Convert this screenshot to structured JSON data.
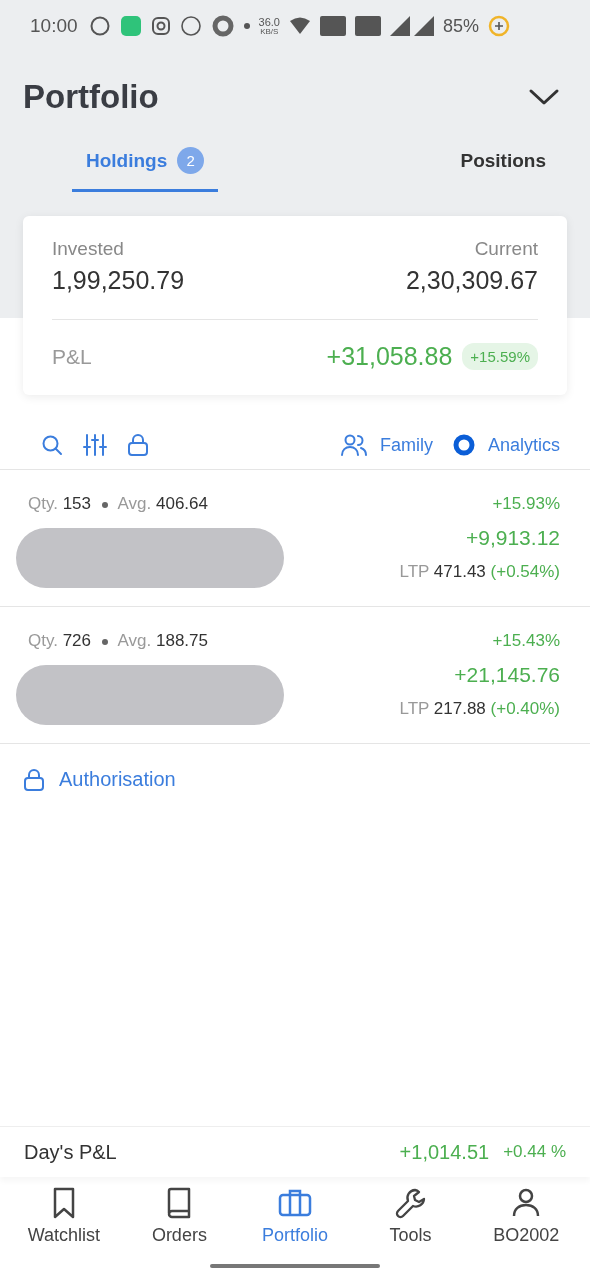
{
  "status_bar": {
    "time": "10:00",
    "speed": "36.0",
    "speed_unit": "KB/S",
    "battery": "85%"
  },
  "header": {
    "title": "Portfolio"
  },
  "tabs": [
    {
      "label": "Holdings",
      "badge": "2",
      "selected": true
    },
    {
      "label": "Positions",
      "selected": false
    }
  ],
  "summary": {
    "invested_label": "Invested",
    "invested": "1,99,250.79",
    "current_label": "Current",
    "current": "2,30,309.67",
    "pnl_label": "P&L",
    "pnl": "+31,058.88",
    "pnl_percent": "+15.59%"
  },
  "toolbar": {
    "family": "Family",
    "analytics": "Analytics"
  },
  "holdings": [
    {
      "qty_label": "Qty.",
      "qty": "153",
      "avg_label": "Avg.",
      "avg": "406.64",
      "change_percent": "+15.93%",
      "pnl": "+9,913.12",
      "ltp_label": "LTP",
      "ltp": "471.43",
      "ltp_change": "(+0.54%)"
    },
    {
      "qty_label": "Qty.",
      "qty": "726",
      "avg_label": "Avg.",
      "avg": "188.75",
      "change_percent": "+15.43%",
      "pnl": "+21,145.76",
      "ltp_label": "LTP",
      "ltp": "217.88",
      "ltp_change": "(+0.40%)"
    }
  ],
  "authorisation": "Authorisation",
  "day_pnl": {
    "label": "Day's P&L",
    "value": "+1,014.51",
    "percent": "+0.44 %"
  },
  "nav": [
    {
      "label": "Watchlist",
      "kind": "bookmark",
      "selected": false
    },
    {
      "label": "Orders",
      "kind": "book",
      "selected": false
    },
    {
      "label": "Portfolio",
      "kind": "briefcase",
      "selected": true
    },
    {
      "label": "Tools",
      "kind": "wrench",
      "selected": false
    },
    {
      "label": "BO2002",
      "kind": "user",
      "selected": false
    }
  ]
}
